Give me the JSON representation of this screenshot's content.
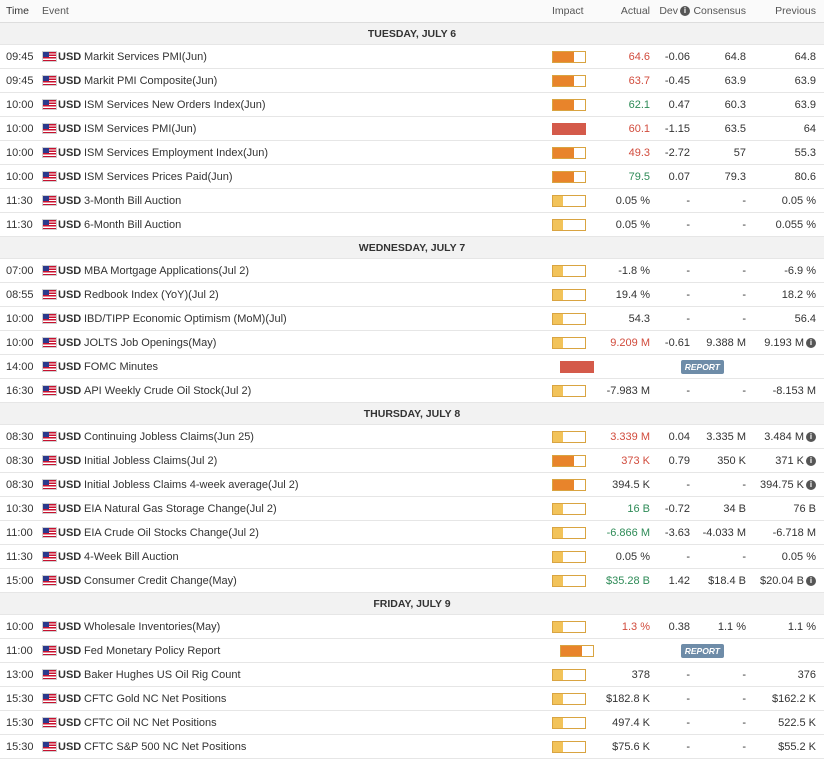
{
  "header": {
    "time": "Time",
    "event": "Event",
    "impact": "Impact",
    "actual": "Actual",
    "dev": "Dev",
    "consensus": "Consensus",
    "previous": "Previous"
  },
  "colors": {
    "high": "#d45a4a",
    "medium": "#e8842b",
    "low": "#f2c35a",
    "red": "#d14b3c",
    "green": "#2e8b57"
  },
  "days": [
    {
      "label": "TUESDAY, JULY 6",
      "events": [
        {
          "time": "09:45",
          "currency": "USD",
          "event": "Markit Services PMI(Jun)",
          "impact": "medium",
          "actual": "64.6",
          "actual_color": "red",
          "dev": "-0.06",
          "consensus": "64.8",
          "previous": "64.8",
          "info": false
        },
        {
          "time": "09:45",
          "currency": "USD",
          "event": "Markit PMI Composite(Jun)",
          "impact": "medium",
          "actual": "63.7",
          "actual_color": "red",
          "dev": "-0.45",
          "consensus": "63.9",
          "previous": "63.9",
          "info": false
        },
        {
          "time": "10:00",
          "currency": "USD",
          "event": "ISM Services New Orders Index(Jun)",
          "impact": "medium",
          "actual": "62.1",
          "actual_color": "green",
          "dev": "0.47",
          "consensus": "60.3",
          "previous": "63.9",
          "info": false
        },
        {
          "time": "10:00",
          "currency": "USD",
          "event": "ISM Services PMI(Jun)",
          "impact": "high",
          "actual": "60.1",
          "actual_color": "red",
          "dev": "-1.15",
          "consensus": "63.5",
          "previous": "64",
          "info": false
        },
        {
          "time": "10:00",
          "currency": "USD",
          "event": "ISM Services Employment Index(Jun)",
          "impact": "medium",
          "actual": "49.3",
          "actual_color": "red",
          "dev": "-2.72",
          "consensus": "57",
          "previous": "55.3",
          "info": false
        },
        {
          "time": "10:00",
          "currency": "USD",
          "event": "ISM Services Prices Paid(Jun)",
          "impact": "medium",
          "actual": "79.5",
          "actual_color": "green",
          "dev": "0.07",
          "consensus": "79.3",
          "previous": "80.6",
          "info": false
        },
        {
          "time": "11:30",
          "currency": "USD",
          "event": "3-Month Bill Auction",
          "impact": "low",
          "actual": "0.05 %",
          "actual_color": "",
          "dev": "-",
          "consensus": "-",
          "previous": "0.05 %",
          "info": false
        },
        {
          "time": "11:30",
          "currency": "USD",
          "event": "6-Month Bill Auction",
          "impact": "low",
          "actual": "0.05 %",
          "actual_color": "",
          "dev": "-",
          "consensus": "-",
          "previous": "0.055 %",
          "info": false
        }
      ]
    },
    {
      "label": "WEDNESDAY, JULY 7",
      "events": [
        {
          "time": "07:00",
          "currency": "USD",
          "event": "MBA Mortgage Applications(Jul 2)",
          "impact": "low",
          "actual": "-1.8 %",
          "actual_color": "",
          "dev": "-",
          "consensus": "-",
          "previous": "-6.9 %",
          "info": false
        },
        {
          "time": "08:55",
          "currency": "USD",
          "event": "Redbook Index (YoY)(Jul 2)",
          "impact": "low",
          "actual": "19.4 %",
          "actual_color": "",
          "dev": "-",
          "consensus": "-",
          "previous": "18.2 %",
          "info": false
        },
        {
          "time": "10:00",
          "currency": "USD",
          "event": "IBD/TIPP Economic Optimism (MoM)(Jul)",
          "impact": "low",
          "actual": "54.3",
          "actual_color": "",
          "dev": "-",
          "consensus": "-",
          "previous": "56.4",
          "info": false
        },
        {
          "time": "10:00",
          "currency": "USD",
          "event": "JOLTS Job Openings(May)",
          "impact": "low",
          "actual": "9.209 M",
          "actual_color": "red",
          "dev": "-0.61",
          "consensus": "9.388 M",
          "previous": "9.193 M",
          "info": true
        },
        {
          "time": "14:00",
          "currency": "USD",
          "event": "FOMC Minutes",
          "impact": "high",
          "actual": "",
          "actual_color": "",
          "dev": "",
          "consensus": "",
          "previous": "",
          "info": false,
          "report": "REPORT"
        },
        {
          "time": "16:30",
          "currency": "USD",
          "event": "API Weekly Crude Oil Stock(Jul 2)",
          "impact": "low",
          "actual": "-7.983 M",
          "actual_color": "",
          "dev": "-",
          "consensus": "-",
          "previous": "-8.153 M",
          "info": false
        }
      ]
    },
    {
      "label": "THURSDAY, JULY 8",
      "events": [
        {
          "time": "08:30",
          "currency": "USD",
          "event": "Continuing Jobless Claims(Jun 25)",
          "impact": "low",
          "actual": "3.339 M",
          "actual_color": "red",
          "dev": "0.04",
          "consensus": "3.335 M",
          "previous": "3.484 M",
          "info": true
        },
        {
          "time": "08:30",
          "currency": "USD",
          "event": "Initial Jobless Claims(Jul 2)",
          "impact": "medium",
          "actual": "373 K",
          "actual_color": "red",
          "dev": "0.79",
          "consensus": "350 K",
          "previous": "371 K",
          "info": true
        },
        {
          "time": "08:30",
          "currency": "USD",
          "event": "Initial Jobless Claims 4-week average(Jul 2)",
          "impact": "medium",
          "actual": "394.5 K",
          "actual_color": "",
          "dev": "-",
          "consensus": "-",
          "previous": "394.75 K",
          "info": true
        },
        {
          "time": "10:30",
          "currency": "USD",
          "event": "EIA Natural Gas Storage Change(Jul 2)",
          "impact": "low",
          "actual": "16 B",
          "actual_color": "green",
          "dev": "-0.72",
          "consensus": "34 B",
          "previous": "76 B",
          "info": false
        },
        {
          "time": "11:00",
          "currency": "USD",
          "event": "EIA Crude Oil Stocks Change(Jul 2)",
          "impact": "low",
          "actual": "-6.866 M",
          "actual_color": "green",
          "dev": "-3.63",
          "consensus": "-4.033 M",
          "previous": "-6.718 M",
          "info": false
        },
        {
          "time": "11:30",
          "currency": "USD",
          "event": "4-Week Bill Auction",
          "impact": "low",
          "actual": "0.05 %",
          "actual_color": "",
          "dev": "-",
          "consensus": "-",
          "previous": "0.05 %",
          "info": false
        },
        {
          "time": "15:00",
          "currency": "USD",
          "event": "Consumer Credit Change(May)",
          "impact": "low",
          "actual": "$35.28 B",
          "actual_color": "green",
          "dev": "1.42",
          "consensus": "$18.4 B",
          "previous": "$20.04 B",
          "info": true
        }
      ]
    },
    {
      "label": "FRIDAY, JULY 9",
      "events": [
        {
          "time": "10:00",
          "currency": "USD",
          "event": "Wholesale Inventories(May)",
          "impact": "low",
          "actual": "1.3 %",
          "actual_color": "red",
          "dev": "0.38",
          "consensus": "1.1 %",
          "previous": "1.1 %",
          "info": false
        },
        {
          "time": "11:00",
          "currency": "USD",
          "event": "Fed Monetary Policy Report",
          "impact": "medium",
          "actual": "",
          "actual_color": "",
          "dev": "",
          "consensus": "",
          "previous": "",
          "info": false,
          "report": "REPORT"
        },
        {
          "time": "13:00",
          "currency": "USD",
          "event": "Baker Hughes US Oil Rig Count",
          "impact": "low",
          "actual": "378",
          "actual_color": "",
          "dev": "-",
          "consensus": "-",
          "previous": "376",
          "info": false
        },
        {
          "time": "15:30",
          "currency": "USD",
          "event": "CFTC Gold NC Net Positions",
          "impact": "low",
          "actual": "$182.8 K",
          "actual_color": "",
          "dev": "-",
          "consensus": "-",
          "previous": "$162.2 K",
          "info": false
        },
        {
          "time": "15:30",
          "currency": "USD",
          "event": "CFTC Oil NC Net Positions",
          "impact": "low",
          "actual": "497.4 K",
          "actual_color": "",
          "dev": "-",
          "consensus": "-",
          "previous": "522.5 K",
          "info": false
        },
        {
          "time": "15:30",
          "currency": "USD",
          "event": "CFTC S&P 500 NC Net Positions",
          "impact": "low",
          "actual": "$75.6 K",
          "actual_color": "",
          "dev": "-",
          "consensus": "-",
          "previous": "$55.2 K",
          "info": false
        }
      ]
    }
  ]
}
